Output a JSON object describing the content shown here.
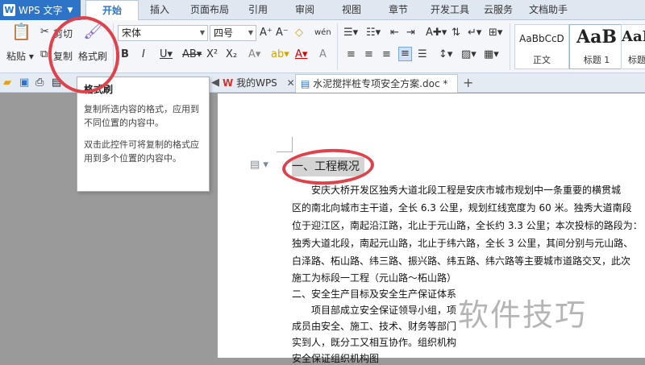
{
  "app": {
    "title": "WPS 文字"
  },
  "ribbon_tabs": [
    "开始",
    "插入",
    "页面布局",
    "引用",
    "审阅",
    "视图",
    "章节",
    "开发工具",
    "云服务",
    "文档助手"
  ],
  "clipboard": {
    "cut": "剪切",
    "paste": "粘贴",
    "copy": "复制",
    "format_painter": "格式刷"
  },
  "font": {
    "name": "宋体",
    "size": "四号"
  },
  "styles": [
    {
      "sample": "AaBbCcD",
      "name": "正文"
    },
    {
      "sample": "AaB",
      "name": "标题 1"
    },
    {
      "sample": "AaB",
      "name": "标题"
    }
  ],
  "doc_tabs": {
    "home": "我的WPS",
    "current": "水泥搅拌桩专项安全方案.doc *"
  },
  "tooltip": {
    "title": "格式刷",
    "line1": "复制所选内容的格式，应用到不同位置的内容中。",
    "line2": "双击此控件可将复制的格式应用到多个位置的内容中。"
  },
  "document": {
    "heading": "一、工程概况",
    "lines": [
      "安庆大桥开发区独秀大道北段工程是安庆市城市规划中一条重要的横贯城",
      "区的南北向城市主干道，全长 6.3 公里，规划红线宽度为 60 米。独秀大道南段",
      "位于迎江区，南起沿江路，北止于元山路，全长约 3.3 公里；本次投标的路段为：",
      "独秀大道北段，南起元山路，北止于纬六路，全长 3 公里，其间分别与元山路、",
      "白泽路、柘山路、纬三路、振兴路、纬五路、纬六路等主要城市道路交叉，此次",
      "施工为标段一工程（元山路～柘山路）",
      "二、安全生产目标及安全生产保证体系",
      "项目部成立安全保证领导小组，项",
      "成员由安全、施工、技术、财务等部门",
      "实到人，既分工又相互协作。组织机构",
      "安全保证组织机构图"
    ]
  },
  "watermark": "软件技巧"
}
